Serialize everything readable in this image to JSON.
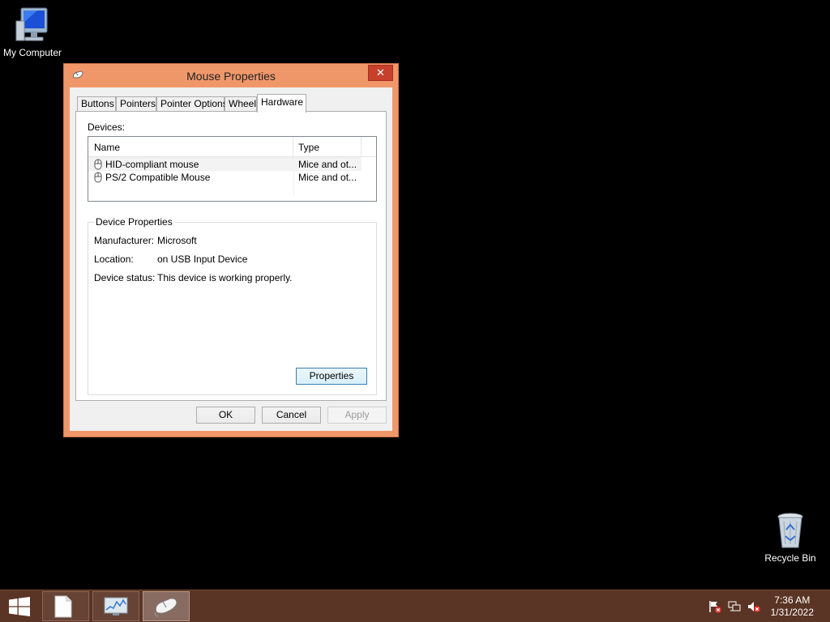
{
  "desktop": {
    "icons": [
      {
        "label": "My Computer",
        "icon": "computer-icon"
      },
      {
        "label": "Recycle Bin",
        "icon": "recycle-bin-icon"
      }
    ]
  },
  "dialog": {
    "title": "Mouse Properties",
    "close_glyph": "✕",
    "tabs": [
      "Buttons",
      "Pointers",
      "Pointer Options",
      "Wheel",
      "Hardware"
    ],
    "active_tab": "Hardware",
    "devices_label": "Devices:",
    "columns": {
      "name": "Name",
      "type": "Type"
    },
    "devices": [
      {
        "name": "HID-compliant mouse",
        "type": "Mice and ot..."
      },
      {
        "name": "PS/2 Compatible Mouse",
        "type": "Mice and ot..."
      }
    ],
    "device_properties": {
      "title": "Device Properties",
      "manufacturer_label": "Manufacturer:",
      "manufacturer": "Microsoft",
      "location_label": "Location:",
      "location": "on USB Input Device",
      "status_label": "Device status:",
      "status": "This device is working properly."
    },
    "buttons": {
      "properties": "Properties",
      "ok": "OK",
      "cancel": "Cancel",
      "apply": "Apply"
    }
  },
  "taskbar": {
    "start_icon": "windows-logo-icon",
    "apps": [
      "file-explorer-icon",
      "performance-monitor-icon",
      "mouse-icon"
    ],
    "tray": [
      "action-center-flag-icon",
      "network-icon",
      "volume-muted-icon"
    ],
    "time": "7:36 AM",
    "date": "1/31/2022"
  },
  "colors": {
    "window_frame": "#f0976a",
    "close_button": "#c7402c",
    "taskbar": "#5a3424",
    "desktop": "#000000"
  }
}
